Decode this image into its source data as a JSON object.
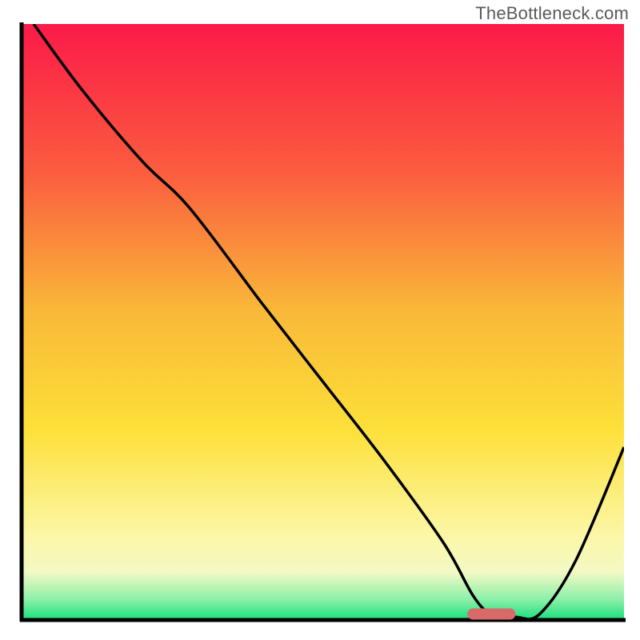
{
  "watermark": "TheBottleneck.com",
  "colors": {
    "gradient_top": "#fb1a48",
    "gradient_mid_upper": "#f9a13a",
    "gradient_mid": "#fde039",
    "gradient_light": "#fcfac1",
    "gradient_bottom": "#18e07c",
    "axis_color": "#000000",
    "line_color": "#000000",
    "marker_fill": "#d86a6a"
  },
  "chart_data": {
    "type": "line",
    "title": "",
    "xlabel": "",
    "ylabel": "",
    "xlim": [
      0,
      100
    ],
    "ylim": [
      0,
      100
    ],
    "annotations": [
      "TheBottleneck.com"
    ],
    "series": [
      {
        "name": "bottleneck-curve",
        "x": [
          2,
          10,
          20,
          28,
          40,
          50,
          60,
          70,
          75,
          78,
          82,
          86,
          92,
          100
        ],
        "y": [
          100,
          89,
          77,
          69,
          53,
          40,
          27,
          13,
          4,
          1,
          0.5,
          1,
          10,
          29
        ]
      }
    ],
    "marker": {
      "name": "optimal-range",
      "x_start": 74,
      "x_end": 82,
      "y": 1
    },
    "gradient_stops": [
      {
        "offset": 0.0,
        "color": "#fb1a48"
      },
      {
        "offset": 0.25,
        "color": "#fb5d3f"
      },
      {
        "offset": 0.48,
        "color": "#f9b839"
      },
      {
        "offset": 0.68,
        "color": "#fde039"
      },
      {
        "offset": 0.86,
        "color": "#fcf7a8"
      },
      {
        "offset": 0.92,
        "color": "#f2f9c4"
      },
      {
        "offset": 0.965,
        "color": "#8df0a9"
      },
      {
        "offset": 1.0,
        "color": "#18e07c"
      }
    ]
  }
}
